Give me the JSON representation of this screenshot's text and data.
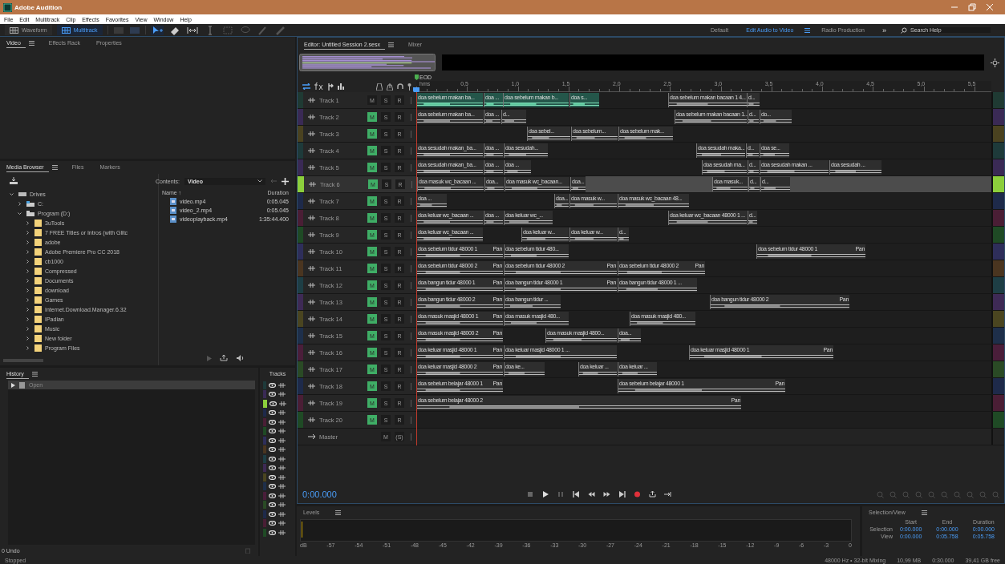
{
  "window": {
    "title": "Adobe Audition"
  },
  "menu": [
    "File",
    "Edit",
    "Multitrack",
    "Clip",
    "Effects",
    "Favorites",
    "View",
    "Window",
    "Help"
  ],
  "toolbar": {
    "views": [
      {
        "label": "Waveform",
        "selected": false
      },
      {
        "label": "Multitrack",
        "selected": true
      }
    ],
    "workspaces": [
      {
        "label": "Default",
        "selected": false
      },
      {
        "label": "Edit Audio to Video",
        "selected": true
      },
      {
        "label": "Radio Production",
        "selected": false
      }
    ],
    "overflow": "»",
    "search": {
      "placeholder": "Search Help"
    }
  },
  "video_panel": {
    "tabs": [
      {
        "label": "Video",
        "selected": true
      },
      {
        "label": "Effects Rack",
        "selected": false
      },
      {
        "label": "Properties",
        "selected": false
      }
    ]
  },
  "media_browser": {
    "tabs": [
      {
        "label": "Media Browser",
        "selected": true
      },
      {
        "label": "Files",
        "selected": false
      },
      {
        "label": "Markers",
        "selected": false
      }
    ],
    "contents_label": "Contents:",
    "contents_value": "Video",
    "tree": [
      {
        "label": "Drives",
        "kind": "drives",
        "expanded": true,
        "children": [
          {
            "label": "C:",
            "kind": "drive",
            "expanded": false
          },
          {
            "label": "Program (D:)",
            "kind": "drive",
            "expanded": true,
            "children": [
              {
                "label": "3uTools",
                "kind": "folder",
                "expanded": false
              },
              {
                "label": "7 FREE Titles or Intros (with Glitc",
                "kind": "folder",
                "expanded": false
              },
              {
                "label": "adobe",
                "kind": "folder",
                "expanded": false
              },
              {
                "label": "Adobe Premiere Pro CC 2018",
                "kind": "folder",
                "expanded": false
              },
              {
                "label": "cb1000",
                "kind": "folder",
                "expanded": false
              },
              {
                "label": "Compressed",
                "kind": "folder",
                "expanded": false
              },
              {
                "label": "Documents",
                "kind": "folder",
                "expanded": false
              },
              {
                "label": "download",
                "kind": "folder",
                "expanded": false
              },
              {
                "label": "Games",
                "kind": "folder",
                "expanded": false
              },
              {
                "label": "Internet.Download.Manager.6.32",
                "kind": "folder",
                "expanded": false
              },
              {
                "label": "IPadian",
                "kind": "folder",
                "expanded": false
              },
              {
                "label": "Music",
                "kind": "folder",
                "expanded": false
              },
              {
                "label": "New folder",
                "kind": "folder",
                "expanded": false
              },
              {
                "label": "Program Files",
                "kind": "folder",
                "expanded": false
              }
            ]
          }
        ]
      }
    ],
    "columns": [
      "Name ↑",
      "Duration"
    ],
    "files": [
      {
        "name": "video.mp4",
        "duration": "0:05.045"
      },
      {
        "name": "video_2.mp4",
        "duration": "0:05.045"
      },
      {
        "name": "videoplayback.mp4",
        "duration": "1:35:44.400"
      }
    ]
  },
  "history": {
    "title": "History",
    "items": [
      {
        "label": "Open",
        "selected": true
      }
    ],
    "undo_count": "0 Undo"
  },
  "tracks_panel": {
    "title": "Tracks",
    "rows": [
      {
        "color": "#1e3a3a",
        "selected": false
      },
      {
        "color": "#3a2a55",
        "selected": false
      },
      {
        "color": "#8ccf3c",
        "selected": true
      },
      {
        "color": "#1e2a4a",
        "selected": false
      },
      {
        "color": "#4a1e35",
        "selected": false
      },
      {
        "color": "#1f4a25",
        "selected": false
      },
      {
        "color": "#2e2e5a",
        "selected": false
      },
      {
        "color": "#4a3520",
        "selected": false
      },
      {
        "color": "#1e3e45",
        "selected": false
      },
      {
        "color": "#3e2a55",
        "selected": false
      },
      {
        "color": "#4a4520",
        "selected": false
      },
      {
        "color": "#1e2f4a",
        "selected": false
      },
      {
        "color": "#4a1e3a",
        "selected": false
      },
      {
        "color": "#2a4a25",
        "selected": false
      },
      {
        "color": "#1e2a4a",
        "selected": false
      },
      {
        "color": "#4a1e35",
        "selected": false
      },
      {
        "color": "#1f4a25",
        "selected": false
      }
    ]
  },
  "editor": {
    "tabs": [
      {
        "label": "Editor: Untitled Session 2.sesx",
        "selected": true
      },
      {
        "label": "Mixer",
        "selected": false
      }
    ],
    "end_marker": "EOD",
    "ruler": [
      "hms",
      "0,5",
      "1,0",
      "1,5",
      "2,0",
      "2,5",
      "3,0",
      "3,5",
      "4,0",
      "4,5",
      "5,0",
      "5,5"
    ],
    "tracks": [
      {
        "name": "Track 1",
        "color": "#1f3a33",
        "selected": false,
        "mute": false,
        "mute_label": "M",
        "solo_label": "S",
        "record_label": "R",
        "clips": [
          {
            "label": "doa sebelum makan ba...",
            "selected": true
          },
          {
            "label": "doa ...",
            "selected": true
          },
          {
            "label": "doa sebelum makan b...",
            "selected": true
          },
          {
            "label": "doa s...",
            "selected": true
          },
          {
            "label": "doa sebelum makan bacaan 1 4...",
            "selected": false
          },
          {
            "label": "d...",
            "selected": false
          }
        ]
      },
      {
        "name": "Track 2",
        "color": "#3a2a55",
        "selected": false,
        "mute": true,
        "mute_label": "M",
        "solo_label": "S",
        "record_label": "R",
        "clips": [
          {
            "label": "doa sebelum makan ba...",
            "selected": false
          },
          {
            "label": "doa ...",
            "selected": false
          },
          {
            "label": "d...",
            "selected": false
          },
          {
            "label": "doa sebelum makan bacaan 1...",
            "selected": false
          },
          {
            "label": "d...",
            "selected": false
          },
          {
            "label": "do...",
            "selected": false
          }
        ]
      },
      {
        "name": "Track 3",
        "color": "#4a4220",
        "selected": false,
        "mute": true,
        "mute_label": "M",
        "solo_label": "S",
        "record_label": "R",
        "clips": [
          {
            "label": "doa sebel...",
            "selected": false
          },
          {
            "label": "doa sebelum...",
            "selected": false
          },
          {
            "label": "doa sebelum mak...",
            "selected": false
          }
        ]
      },
      {
        "name": "Track 4",
        "color": "#1e3a3a",
        "selected": false,
        "mute": true,
        "mute_label": "M",
        "solo_label": "S",
        "record_label": "R",
        "clips": [
          {
            "label": "doa sesudah makan_ba...",
            "selected": false
          },
          {
            "label": "doa ...",
            "selected": false
          },
          {
            "label": "doa sesudah...",
            "selected": false
          },
          {
            "label": "doa sesudah maka...",
            "selected": false
          },
          {
            "label": "d...",
            "selected": false
          },
          {
            "label": "doa se...",
            "selected": false
          }
        ]
      },
      {
        "name": "Track 5",
        "color": "#3a2a55",
        "selected": false,
        "mute": true,
        "mute_label": "M",
        "solo_label": "S",
        "record_label": "R",
        "clips": [
          {
            "label": "doa sesudah makan_ba...",
            "selected": false
          },
          {
            "label": "doa ...",
            "selected": false
          },
          {
            "label": "doa ...",
            "selected": false
          },
          {
            "label": "doa sesudah ma...",
            "selected": false
          },
          {
            "label": "d...",
            "selected": false
          },
          {
            "label": "doa sesudah makan ...",
            "selected": false
          },
          {
            "label": "doa sesudah ...",
            "selected": false
          }
        ]
      },
      {
        "name": "Track 6",
        "color": "#8ccf3c",
        "selected": true,
        "mute": true,
        "mute_label": "M",
        "solo_label": "S",
        "record_label": "R",
        "clips": [
          {
            "label": "doa masuk wc_bacaan ...",
            "selected": false
          },
          {
            "label": "doa...",
            "selected": false
          },
          {
            "label": "doa masuk wc_bacaan...",
            "selected": false
          },
          {
            "label": "doa...",
            "selected": false
          },
          {
            "label": "doa masuk...",
            "selected": false
          },
          {
            "label": "d...",
            "selected": false
          },
          {
            "label": "d...",
            "selected": false
          }
        ]
      },
      {
        "name": "Track 7",
        "color": "#1e2a4a",
        "selected": false,
        "mute": true,
        "mute_label": "M",
        "solo_label": "S",
        "record_label": "R",
        "clips": [
          {
            "label": "doa ...",
            "selected": false
          },
          {
            "label": "doa...",
            "selected": false
          },
          {
            "label": "doa masuk w...",
            "selected": false
          },
          {
            "label": "doa masuk wc_bacaan 48...",
            "selected": false
          }
        ]
      },
      {
        "name": "Track 8",
        "color": "#4a1e35",
        "selected": false,
        "mute": true,
        "mute_label": "M",
        "solo_label": "S",
        "record_label": "R",
        "clips": [
          {
            "label": "doa keluar wc_bacaan ...",
            "selected": false
          },
          {
            "label": "doa ...",
            "selected": false
          },
          {
            "label": "doa keluar wc_...",
            "selected": false
          },
          {
            "label": "doa keluar wc_bacaan 48000 1 ...",
            "selected": false
          },
          {
            "label": "d...",
            "selected": false
          }
        ]
      },
      {
        "name": "Track 9",
        "color": "#1f4a25",
        "selected": false,
        "mute": true,
        "mute_label": "M",
        "solo_label": "S",
        "record_label": "R",
        "clips": [
          {
            "label": "doa keluar wc_bacaan ...",
            "selected": false
          },
          {
            "label": "doa keluar w...",
            "selected": false
          },
          {
            "label": "doa keluar w...",
            "selected": false
          },
          {
            "label": "d...",
            "selected": false
          }
        ]
      },
      {
        "name": "Track 10",
        "color": "#2e2e5a",
        "selected": false,
        "mute": true,
        "mute_label": "M",
        "solo_label": "S",
        "record_label": "R",
        "clips": [
          {
            "label": "doa sebelum tidur 48000 1",
            "pan": "Pan",
            "selected": false
          },
          {
            "label": "doa sebelum tidur 480...",
            "selected": false
          },
          {
            "label": "doa sebelum tidur 48000 1",
            "pan": "Pan",
            "selected": false
          }
        ]
      },
      {
        "name": "Track 11",
        "color": "#4a3520",
        "selected": false,
        "mute": true,
        "mute_label": "M",
        "solo_label": "S",
        "record_label": "R",
        "clips": [
          {
            "label": "doa sebelum tidur 48000 2",
            "pan": "Pan",
            "selected": false
          },
          {
            "label": "doa sebelum tidur 48000 2",
            "pan": "Pan",
            "selected": false
          },
          {
            "label": "doa sebelum tidur 48000 2",
            "pan": "Pan",
            "selected": false
          }
        ]
      },
      {
        "name": "Track 12",
        "color": "#1e3e45",
        "selected": false,
        "mute": true,
        "mute_label": "M",
        "solo_label": "S",
        "record_label": "R",
        "clips": [
          {
            "label": "doa bangun tidur 48000 1",
            "pan": "Pan",
            "selected": false
          },
          {
            "label": "doa bangun tidur 48000 1",
            "pan": "Pan",
            "selected": false
          },
          {
            "label": "doa bangun tidur 48000 1 ...",
            "selected": false
          }
        ]
      },
      {
        "name": "Track 13",
        "color": "#3e2a55",
        "selected": false,
        "mute": true,
        "mute_label": "M",
        "solo_label": "S",
        "record_label": "R",
        "clips": [
          {
            "label": "doa bangun tidur 48000 2",
            "pan": "Pan",
            "selected": false
          },
          {
            "label": "doa bangun tidur ...",
            "selected": false
          },
          {
            "label": "doa bangun tidur 48000 2",
            "pan": "Pan",
            "selected": false
          }
        ]
      },
      {
        "name": "Track 14",
        "color": "#4a4520",
        "selected": false,
        "mute": true,
        "mute_label": "M",
        "solo_label": "S",
        "record_label": "R",
        "clips": [
          {
            "label": "doa masuk masjid 48000 1",
            "pan": "Pan",
            "selected": false
          },
          {
            "label": "doa masuk masjid 480...",
            "selected": false
          },
          {
            "label": "doa masuk masjid 480...",
            "selected": false
          }
        ]
      },
      {
        "name": "Track 15",
        "color": "#1e2f4a",
        "selected": false,
        "mute": true,
        "mute_label": "M",
        "solo_label": "S",
        "record_label": "R",
        "clips": [
          {
            "label": "doa masuk masjid 48000 2",
            "pan": "Pan",
            "selected": false
          },
          {
            "label": "doa masuk masjid 4800...",
            "selected": false
          },
          {
            "label": "doa...",
            "selected": false
          }
        ]
      },
      {
        "name": "Track 16",
        "color": "#4a1e3a",
        "selected": false,
        "mute": true,
        "mute_label": "M",
        "solo_label": "S",
        "record_label": "R",
        "clips": [
          {
            "label": "doa keluar masjid 48000 1",
            "pan": "Pan",
            "selected": false
          },
          {
            "label": "doa keluar masjid 48000 1 ...",
            "selected": false
          },
          {
            "label": "doa keluar masjid 48000 1",
            "pan": "Pan",
            "selected": false
          }
        ]
      },
      {
        "name": "Track 17",
        "color": "#2a4a25",
        "selected": false,
        "mute": true,
        "mute_label": "M",
        "solo_label": "S",
        "record_label": "R",
        "clips": [
          {
            "label": "doa keluar masjid 48000 2",
            "pan": "Pan",
            "selected": false
          },
          {
            "label": "doa ke...",
            "selected": false
          },
          {
            "label": "doa keluar ...",
            "selected": false
          },
          {
            "label": "doa keluar ...",
            "selected": false
          }
        ]
      },
      {
        "name": "Track 18",
        "color": "#1e2a4a",
        "selected": false,
        "mute": true,
        "mute_label": "M",
        "solo_label": "S",
        "record_label": "R",
        "clips": [
          {
            "label": "doa sebelum belajar 48000 1",
            "pan": "Pan",
            "selected": false
          },
          {
            "label": "doa sebelum belajar 48000 1",
            "pan": "Pan",
            "selected": false
          }
        ]
      },
      {
        "name": "Track 19",
        "color": "#4a1e35",
        "selected": false,
        "mute": true,
        "mute_label": "M",
        "solo_label": "S",
        "record_label": "R",
        "clips": [
          {
            "label": "doa sebelum belajar 48000 2",
            "pan": "Pan",
            "selected": false
          }
        ]
      },
      {
        "name": "Track 20",
        "color": "#1f4a25",
        "selected": false,
        "mute": true,
        "mute_label": "M",
        "solo_label": "S",
        "record_label": "R"
      }
    ],
    "master": {
      "name": "Master",
      "mute_label": "M",
      "solo_label": "(S)"
    },
    "time": "0:00.000"
  },
  "levels": {
    "title": "Levels",
    "scale": [
      "dB",
      "-57",
      "-54",
      "-51",
      "-48",
      "-45",
      "-42",
      "-39",
      "-36",
      "-33",
      "-30",
      "-27",
      "-24",
      "-21",
      "-18",
      "-15",
      "-12",
      "-9",
      "-6",
      "-3",
      "0"
    ]
  },
  "selection_view": {
    "title": "Selection/View",
    "columns": [
      "Start",
      "End",
      "Duration"
    ],
    "rows": [
      {
        "label": "Selection",
        "values": [
          "0:00.000",
          "0:00.000",
          "0:00.000"
        ]
      },
      {
        "label": "View",
        "values": [
          "0:00.000",
          "0:05.758",
          "0:05.758"
        ]
      }
    ]
  },
  "status_bar": {
    "state": "Stopped",
    "info": [
      "48000 Hz • 32-bit Mixing",
      "10,99 MB",
      "0:30.000",
      "39,41 GB free"
    ]
  }
}
